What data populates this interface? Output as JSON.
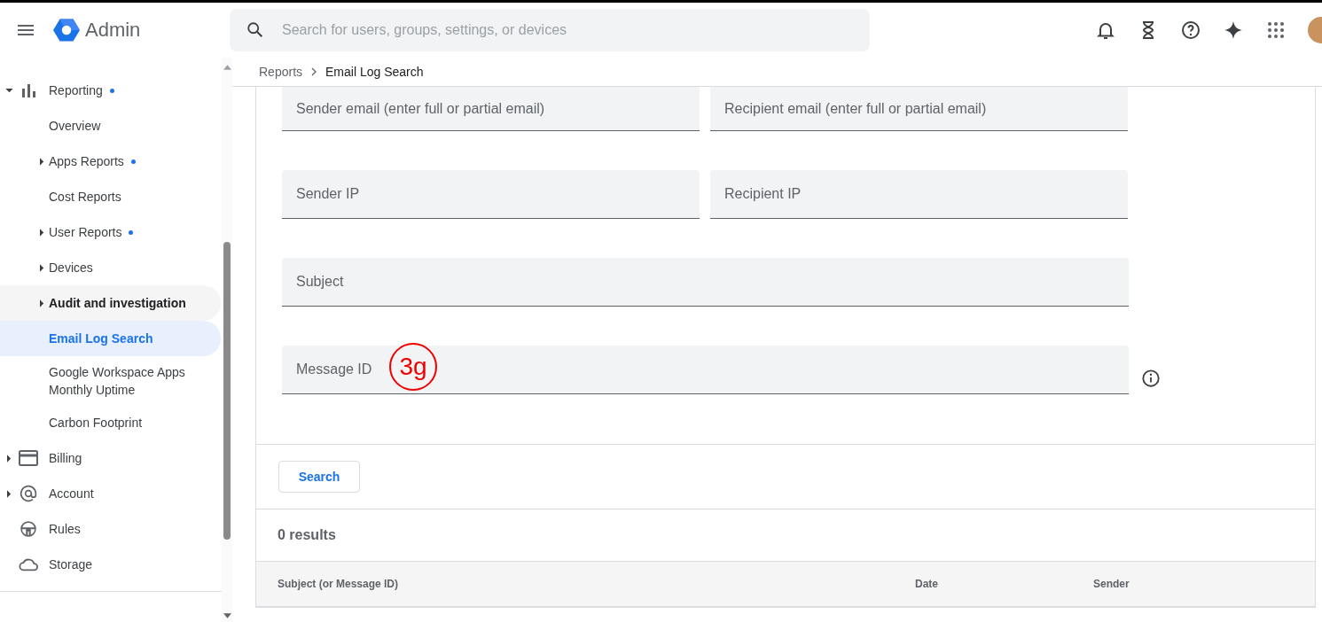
{
  "app": {
    "title": "Admin"
  },
  "search": {
    "placeholder": "Search for users, groups, settings, or devices"
  },
  "sidebar": {
    "items": [
      {
        "label": "Reporting",
        "expanded": true,
        "dot": true,
        "selected": false,
        "children": [
          {
            "label": "Overview",
            "caret": false,
            "dot": false,
            "selected": false,
            "hovered": false
          },
          {
            "label": "Apps Reports",
            "caret": true,
            "dot": true,
            "selected": false,
            "hovered": false
          },
          {
            "label": "Cost Reports",
            "caret": false,
            "dot": false,
            "selected": false,
            "hovered": false
          },
          {
            "label": "User Reports",
            "caret": true,
            "dot": true,
            "selected": false,
            "hovered": false
          },
          {
            "label": "Devices",
            "caret": true,
            "dot": false,
            "selected": false,
            "hovered": false
          },
          {
            "label": "Audit and investigation",
            "caret": true,
            "dot": false,
            "selected": false,
            "hovered": true
          },
          {
            "label": "Email Log Search",
            "caret": false,
            "dot": false,
            "selected": true,
            "hovered": false
          },
          {
            "label": "Google Workspace Apps Monthly Uptime",
            "caret": false,
            "dot": false,
            "selected": false,
            "hovered": false
          },
          {
            "label": "Carbon Footprint",
            "caret": false,
            "dot": false,
            "selected": false,
            "hovered": false
          }
        ]
      },
      {
        "label": "Billing",
        "expanded": false,
        "dot": false,
        "selected": false
      },
      {
        "label": "Account",
        "expanded": false,
        "dot": false,
        "selected": false
      },
      {
        "label": "Rules",
        "dot": false,
        "selected": false
      },
      {
        "label": "Storage",
        "dot": false,
        "selected": false
      }
    ]
  },
  "breadcrumb": [
    "Reports",
    "Email Log Search"
  ],
  "form": {
    "rows": [
      [
        {
          "placeholder": "Sender email (enter full or partial email)"
        },
        {
          "placeholder": "Recipient email (enter full or partial email)"
        }
      ],
      [
        {
          "placeholder": "Sender IP"
        },
        {
          "placeholder": "Recipient IP"
        }
      ],
      [
        {
          "placeholder": "Subject"
        }
      ],
      [
        {
          "placeholder": "Message ID",
          "info": true
        }
      ]
    ]
  },
  "annotation": {
    "label": "3g"
  },
  "search_button": "Search",
  "results": {
    "count": "0 results",
    "columns": [
      "Subject (or Message ID)",
      "Date",
      "Sender"
    ]
  }
}
